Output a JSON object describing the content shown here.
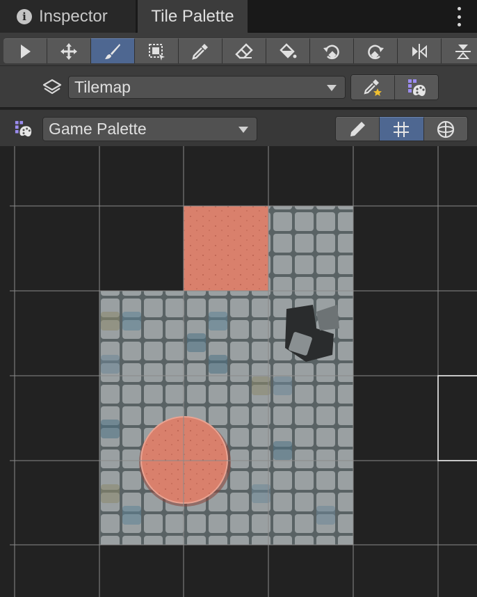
{
  "tabs": [
    {
      "label": "Inspector",
      "active": false,
      "icon": "info-icon"
    },
    {
      "label": "Tile Palette",
      "active": true
    }
  ],
  "toolbar": {
    "tools": [
      {
        "name": "select-arrow",
        "selected": false
      },
      {
        "name": "move",
        "selected": false
      },
      {
        "name": "paint-brush",
        "selected": true
      },
      {
        "name": "box-fill",
        "selected": false
      },
      {
        "name": "picker",
        "selected": false
      },
      {
        "name": "eraser",
        "selected": false
      },
      {
        "name": "flood-fill",
        "selected": false
      },
      {
        "name": "rotate-counterclockwise",
        "selected": false
      },
      {
        "name": "rotate-clockwise",
        "selected": false
      },
      {
        "name": "flip-x",
        "selected": false
      },
      {
        "name": "flip-y",
        "selected": false
      }
    ]
  },
  "target": {
    "icon": "layers-icon",
    "selected": "Tilemap",
    "buttons": [
      "picker-star-icon",
      "palette-grid-icon"
    ]
  },
  "palette": {
    "icon": "palette-icon",
    "selected": "Game Palette",
    "modes": [
      {
        "name": "edit-pencil",
        "selected": false
      },
      {
        "name": "grid",
        "selected": true
      },
      {
        "name": "gizmo",
        "selected": false
      }
    ]
  },
  "colors": {
    "accent": "#4e6791",
    "panel": "#3c3c3c",
    "canvas": "#222222",
    "salmon": "#d8806d",
    "stone": "#8e9598"
  }
}
